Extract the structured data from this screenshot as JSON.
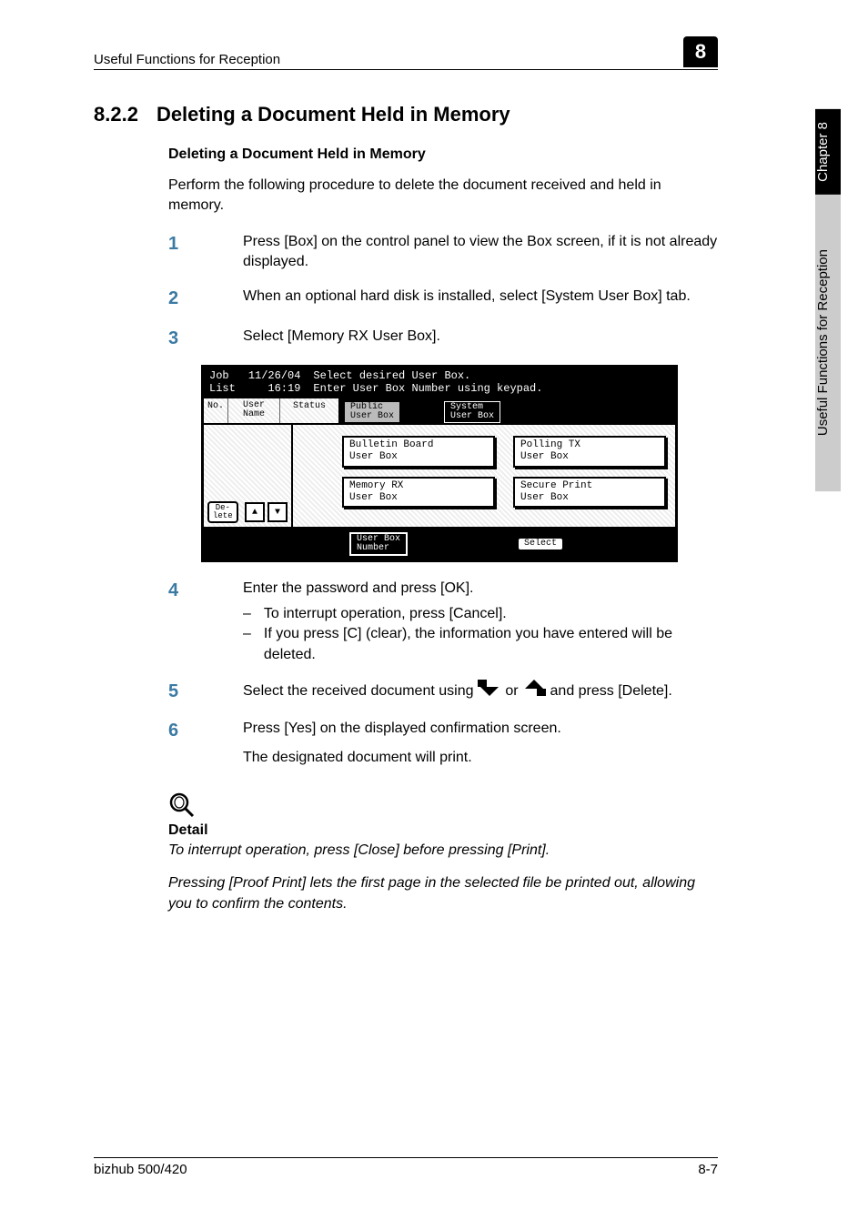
{
  "header": {
    "section": "Useful Functions for Reception",
    "chapter_number": "8"
  },
  "side_tab": {
    "chapter_label": "Chapter 8",
    "title": "Useful Functions for Reception"
  },
  "h2_number": "8.2.2",
  "h2_title": "Deleting a Document Held in Memory",
  "h3_title": "Deleting a Document Held in Memory",
  "intro": "Perform the following procedure to delete the document received and held in memory.",
  "steps": {
    "s1": "Press [Box] on the control panel to view the Box screen, if it is not already displayed.",
    "s2": "When an optional hard disk is installed, select [System User Box] tab.",
    "s3": "Select [Memory RX User Box].",
    "s4": "Enter the password and press [OK].",
    "s4a": "To interrupt operation, press [Cancel].",
    "s4b": "If you press [C] (clear), the information you have entered will be deleted.",
    "s5_pre": "Select the received document using ",
    "s5_mid": " or ",
    "s5_post": " and press [Delete].",
    "s6": "Press [Yes] on the displayed confirmation screen.",
    "s6_result": "The designated document will print."
  },
  "screenshot": {
    "job_list": "Job\nList",
    "date": "11/26/04",
    "time": "16:19",
    "msg1": "Select desired User Box.",
    "msg2": "Enter User Box Number using keypad.",
    "col_no": "No.",
    "col_user": "User\nName",
    "col_status": "Status",
    "tab_public": "Public\nUser Box",
    "tab_system": "System\nUser Box",
    "box_bulletin": "Bulletin Board\nUser Box",
    "box_polling": "Polling TX\nUser Box",
    "box_memory": "Memory RX\nUser Box",
    "box_secure": "Secure Print\nUser Box",
    "delete": "De-\nlete",
    "user_box_number": "User Box\nNumber",
    "select": "Select"
  },
  "detail": {
    "label": "Detail",
    "p1": "To interrupt operation, press [Close] before pressing [Print].",
    "p2": "Pressing [Proof Print] lets the first page in the selected file be printed out, allowing you to confirm the contents."
  },
  "footer": {
    "product": "bizhub 500/420",
    "page": "8-7"
  }
}
